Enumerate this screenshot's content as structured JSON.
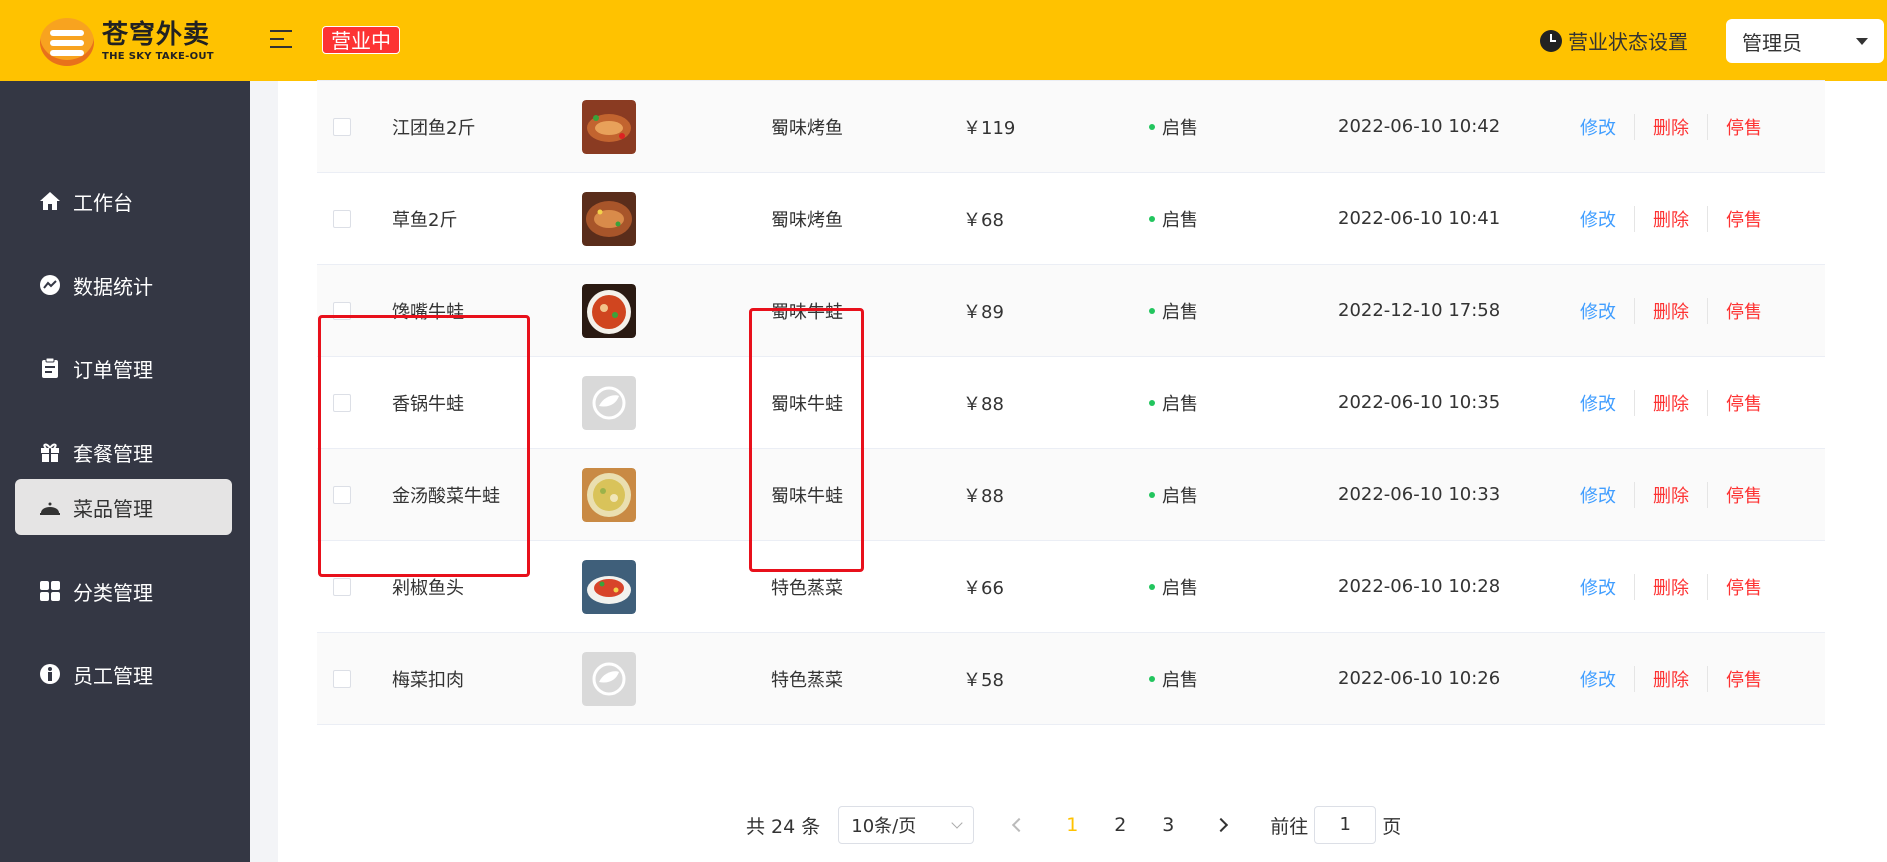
{
  "header": {
    "logo_cn": "苍穹外卖",
    "logo_en": "THE SKY TAKE-OUT",
    "status_tag": "营业中",
    "biz_setting": "营业状态设置",
    "admin": "管理员",
    "colors": {
      "bar": "#ffc200",
      "tag": "#fd3333"
    }
  },
  "sidebar": {
    "items": [
      {
        "label": "工作台",
        "icon": "home-icon"
      },
      {
        "label": "数据统计",
        "icon": "chart-icon"
      },
      {
        "label": "订单管理",
        "icon": "clipboard-icon"
      },
      {
        "label": "套餐管理",
        "icon": "gift-icon"
      },
      {
        "label": "菜品管理",
        "icon": "dish-cover-icon",
        "active": true
      },
      {
        "label": "分类管理",
        "icon": "grid-icon"
      },
      {
        "label": "员工管理",
        "icon": "employee-icon"
      }
    ]
  },
  "table": {
    "rows": [
      {
        "name": "江团鱼2斤",
        "category": "蜀味烤鱼",
        "price": "￥119",
        "status": "启售",
        "time": "2022-06-10 10:42",
        "img": "fish-dish"
      },
      {
        "name": "草鱼2斤",
        "category": "蜀味烤鱼",
        "price": "￥68",
        "status": "启售",
        "time": "2022-06-10 10:41",
        "img": "fish-dish"
      },
      {
        "name": "馋嘴牛蛙",
        "category": "蜀味牛蛙",
        "price": "￥89",
        "status": "启售",
        "time": "2022-12-10 17:58",
        "img": "bowl-dish"
      },
      {
        "name": "香锅牛蛙",
        "category": "蜀味牛蛙",
        "price": "￥88",
        "status": "启售",
        "time": "2022-06-10 10:35",
        "img": "placeholder"
      },
      {
        "name": "金汤酸菜牛蛙",
        "category": "蜀味牛蛙",
        "price": "￥88",
        "status": "启售",
        "time": "2022-06-10 10:33",
        "img": "soup-dish"
      },
      {
        "name": "剁椒鱼头",
        "category": "特色蒸菜",
        "price": "￥66",
        "status": "启售",
        "time": "2022-06-10 10:28",
        "img": "fish-head"
      },
      {
        "name": "梅菜扣肉",
        "category": "特色蒸菜",
        "price": "￥58",
        "status": "启售",
        "time": "2022-06-10 10:26",
        "img": "placeholder"
      }
    ],
    "actions": {
      "edit": "修改",
      "delete": "删除",
      "stop": "停售"
    }
  },
  "pager": {
    "total": "共 24 条",
    "page_size": "10条/页",
    "pages": [
      "1",
      "2",
      "3"
    ],
    "current": "1",
    "goto_prefix": "前往",
    "goto_value": "1",
    "goto_suffix": "页"
  }
}
